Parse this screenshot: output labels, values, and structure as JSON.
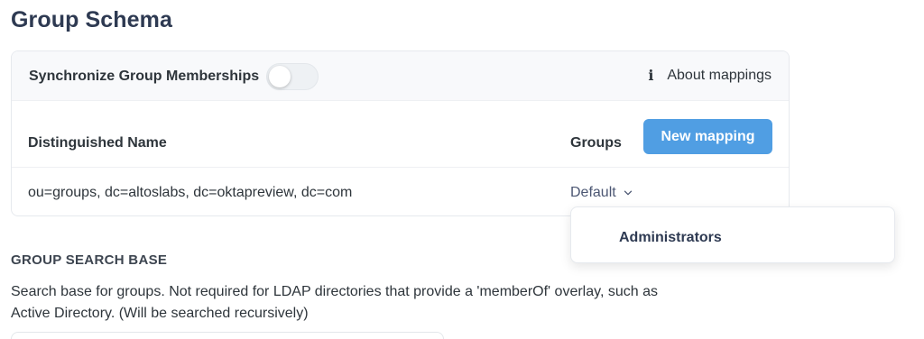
{
  "page": {
    "title": "Group Schema"
  },
  "card": {
    "sync_label": "Synchronize Group Memberships",
    "sync_enabled": false,
    "about_label": "About mappings",
    "about_icon": "info-icon",
    "columns": {
      "distinguished_name": "Distinguished Name",
      "groups": "Groups"
    },
    "new_mapping_label": "New mapping",
    "rows": [
      {
        "dn": "ou=groups, dc=altoslabs, dc=oktapreview, dc=com",
        "group": "Default"
      }
    ]
  },
  "dropdown": {
    "items": [
      "Administrators"
    ]
  },
  "group_search_base": {
    "title": "GROUP SEARCH BASE",
    "description": "Search base for groups. Not required for LDAP directories that provide a 'memberOf' overlay, such as Active Directory. (Will be searched recursively)"
  },
  "colors": {
    "accent": "#509ee3",
    "title": "#2e3a52",
    "text": "#2e353b"
  }
}
